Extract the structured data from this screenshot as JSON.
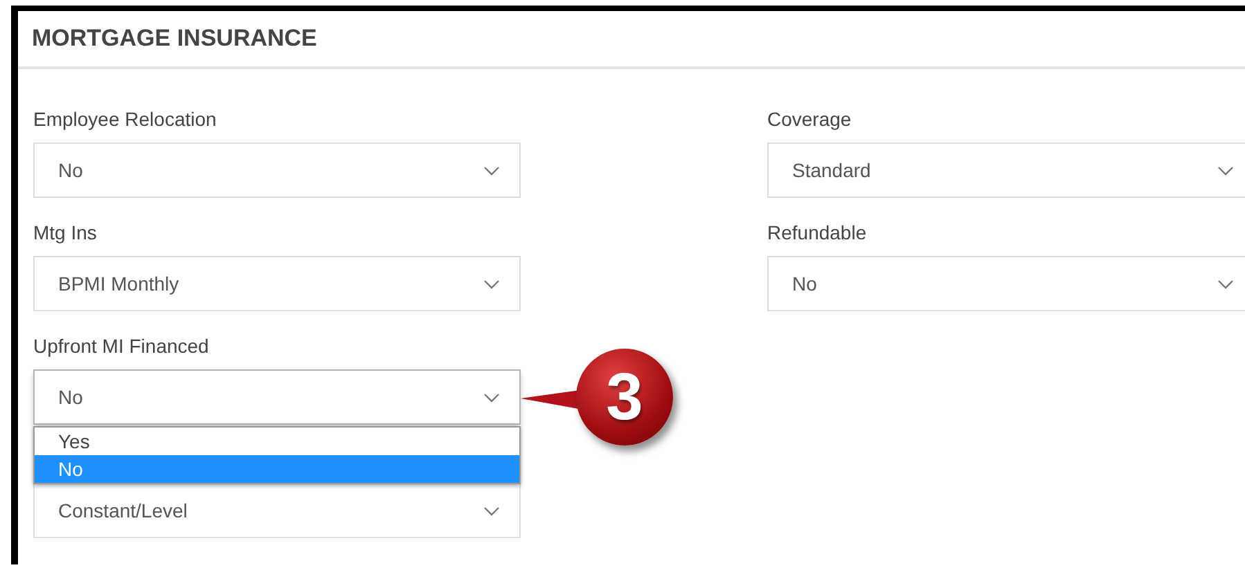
{
  "header": {
    "title": "MORTGAGE INSURANCE"
  },
  "fields": [
    {
      "label": "Employee Relocation",
      "value": "No",
      "expanded": false
    },
    {
      "label": "Coverage",
      "value": "Standard",
      "expanded": false
    },
    {
      "label": "Mtg Ins",
      "value": "BPMI Monthly",
      "expanded": false
    },
    {
      "label": "Refundable",
      "value": "No",
      "expanded": false
    },
    {
      "label": "Upfront MI Financed",
      "value": "No",
      "expanded": true,
      "options": [
        {
          "label": "Yes",
          "selected": false
        },
        {
          "label": "No",
          "selected": true
        }
      ]
    },
    {
      "value": "Constant/Level",
      "expanded": false
    }
  ],
  "callout": {
    "number": "3"
  }
}
